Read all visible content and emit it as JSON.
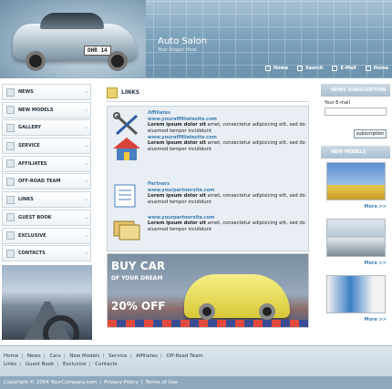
{
  "header": {
    "title": "Auto Salon",
    "slogan": "Your Slogan Here",
    "plate": "OHR 14",
    "nav": [
      {
        "label": "Home",
        "icon": "home-icon"
      },
      {
        "label": "Search",
        "icon": "search-icon"
      },
      {
        "label": "E-Mail",
        "icon": "email-icon"
      },
      {
        "label": "Home",
        "icon": "home-icon"
      }
    ]
  },
  "left_menu": [
    {
      "label": "NEWS"
    },
    {
      "label": "NEW MODELS"
    },
    {
      "label": "GALLERY"
    },
    {
      "label": "SERVICE"
    },
    {
      "label": "AFFILIATES"
    },
    {
      "label": "OFF-ROAD TEAM"
    },
    {
      "label": "LINKS"
    },
    {
      "label": "GUEST BOOK"
    },
    {
      "label": "EXCLUSIVE"
    },
    {
      "label": "CONTACTS"
    }
  ],
  "center": {
    "heading": "LINKS",
    "affiliates": [
      {
        "title": "Affiliates",
        "url": "www.yourafffiliatesite.com",
        "desc_bold": "Lorem ipsum dolor sit",
        "desc": "amet, consectetur adipisicing elit, sed do eiusmod tempor incididunt",
        "desc_bold2": "Lorem ipsum dolor sit",
        "desc2": "amet, consectetur adipisicing elit, sed do eiusmod tempor incididunt"
      },
      {
        "title": "",
        "url": "www.yourafffiliatesite.com",
        "desc_bold": "Lorem ipsum dolor sit",
        "desc": "amet, consectetur adipisicing elit, sed do eiusmod tempor incididunt",
        "desc_bold2": "",
        "desc2": ""
      },
      {
        "title": "Partners",
        "url": "www.yourpartnersite.com",
        "desc_bold": "Lorem ipsum dolor sit",
        "desc": "amet, consectetur adipisicing elit, sed do eiusmod tempor incididunt",
        "desc_bold2": "",
        "desc2": ""
      },
      {
        "title": "",
        "url": "www.yourpartnersite.com",
        "desc_bold": "Lorem ipsum dolor sit",
        "desc": "amet, consectetur adipisicing elit, sed do eiusmod tempor incididunt",
        "desc_bold2": "",
        "desc2": ""
      }
    ],
    "promo": {
      "line1": "BUY CAR",
      "line2": "OF YOUR DREAM",
      "line3": "20% OFF"
    }
  },
  "right": {
    "newsletter_title": "NEWS SUBSCRIPTION",
    "email_label": "Your E-mail",
    "email_value": "",
    "subscribe_label": "subscription",
    "models_title": "NEW MODELS",
    "more_label": "More >>"
  },
  "footer": {
    "links": [
      "Home",
      "News",
      "Cars",
      "New Models",
      "Service",
      "Affiliates",
      "Off-Road Team",
      "Links",
      "Guest Book",
      "Exclusive",
      "Contacts"
    ],
    "copyright": "Copyright © 2004 YourCompany.com",
    "privacy": "Privacy Policy",
    "terms": "Terms of Use"
  },
  "colors": {
    "accent": "#3d7fb4",
    "header": "#7fa3bd",
    "footer_bar": "#8ea8bd"
  }
}
